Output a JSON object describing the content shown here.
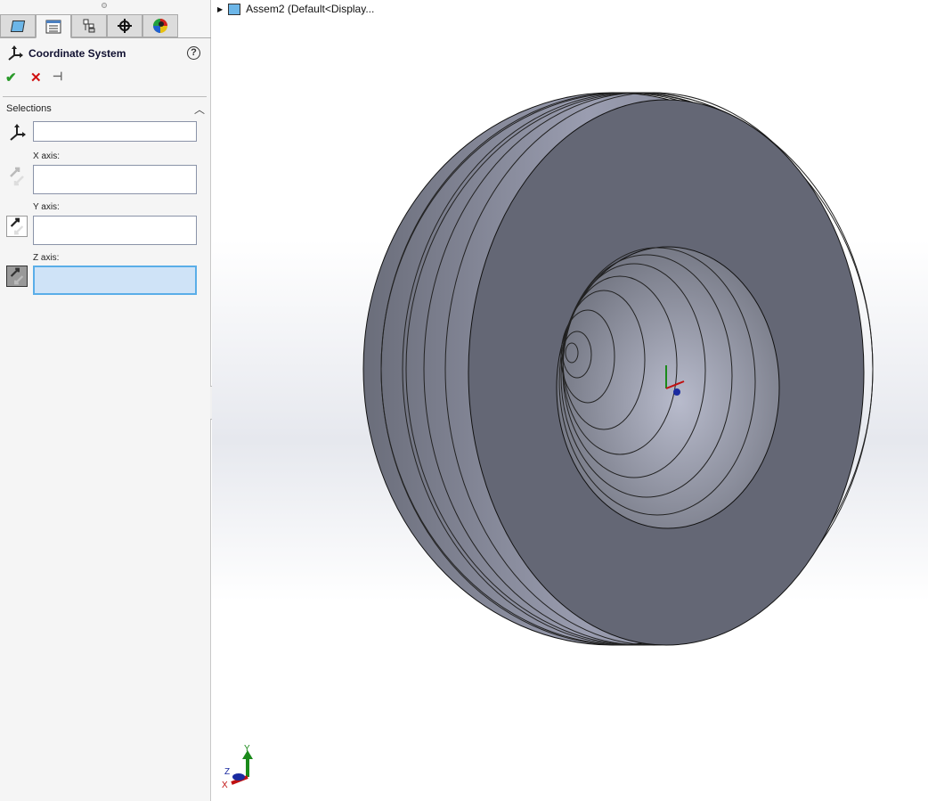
{
  "panel": {
    "title": "Coordinate System",
    "help": "?",
    "ok": "✔",
    "cancel": "✕",
    "pin": "⊣",
    "tabs": [
      "feature-manager",
      "property-manager",
      "configuration-manager",
      "dimxpert-manager",
      "display-manager"
    ],
    "section": "Selections",
    "x_label": "X axis:",
    "y_label": "Y axis:",
    "z_label": "Z axis:",
    "origin_value": "",
    "x_value": "",
    "y_value": "",
    "z_value": ""
  },
  "tree": {
    "item": "Assem2  (Default<Display..."
  },
  "triad": {
    "x": "X",
    "y": "Y",
    "z": "Z"
  },
  "colors": {
    "active_field": "#cfe3f7",
    "model": "#6b6e7a",
    "ok": "#2a9a2a",
    "cancel": "#d01010"
  }
}
